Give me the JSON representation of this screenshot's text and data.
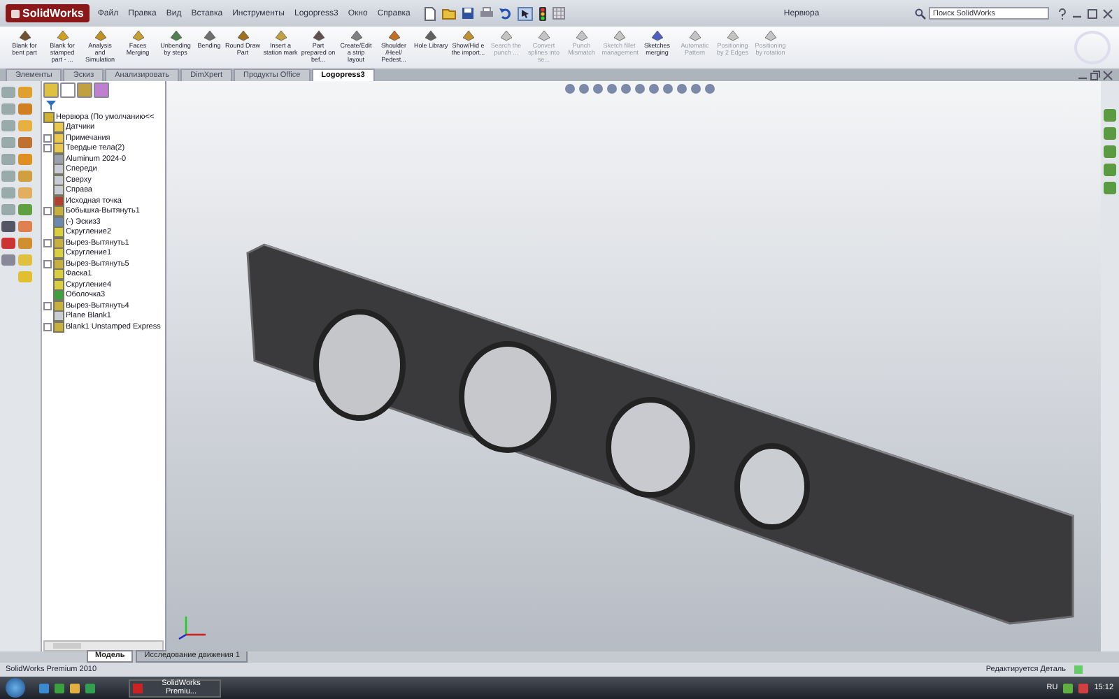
{
  "window": {
    "logo": "SolidWorks",
    "title": "Нервюра",
    "search": {
      "placeholder": "Поиск SolidWorks"
    }
  },
  "menu": [
    "Файл",
    "Правка",
    "Вид",
    "Вставка",
    "Инструменты",
    "Logopress3",
    "Окно",
    "Справка"
  ],
  "ribbon": [
    {
      "label": "Blank for bent part",
      "disabled": false
    },
    {
      "label": "Blank for stamped part - ...",
      "disabled": false
    },
    {
      "label": "Analysis and Simulation",
      "disabled": false
    },
    {
      "label": "Faces Merging",
      "disabled": false
    },
    {
      "label": "Unbending by steps",
      "disabled": false
    },
    {
      "label": "Bending",
      "disabled": false
    },
    {
      "label": "Round Draw Part",
      "disabled": false
    },
    {
      "label": "Insert a station mark",
      "disabled": false
    },
    {
      "label": "Part prepared on bef...",
      "disabled": false
    },
    {
      "label": "Create/Edit a strip layout",
      "disabled": false
    },
    {
      "label": "Shoulder /Heel/ Pedest...",
      "disabled": false
    },
    {
      "label": "Hole Library",
      "disabled": false
    },
    {
      "label": "Show/Hid e the import...",
      "disabled": false
    },
    {
      "label": "Search the punch ...",
      "disabled": true
    },
    {
      "label": "Convert splines into se...",
      "disabled": true
    },
    {
      "label": "Punch Mismatch",
      "disabled": true
    },
    {
      "label": "Sketch fillet management",
      "disabled": true
    },
    {
      "label": "Sketches merging",
      "disabled": false
    },
    {
      "label": "Automatic Pattern",
      "disabled": true
    },
    {
      "label": "Positioning by 2 Edges",
      "disabled": true
    },
    {
      "label": "Positioning by rotation",
      "disabled": true
    }
  ],
  "command_tabs": [
    {
      "label": "Элементы",
      "selected": false
    },
    {
      "label": "Эскиз",
      "selected": false
    },
    {
      "label": "Анализировать",
      "selected": false
    },
    {
      "label": "DimXpert",
      "selected": false
    },
    {
      "label": "Продукты Office",
      "selected": false
    },
    {
      "label": "Logopress3",
      "selected": true
    }
  ],
  "tree": {
    "root": "Нервюра  (По умолчанию<<",
    "items": [
      {
        "label": "Датчики",
        "kind": "folder",
        "collapsed": false
      },
      {
        "label": "Примечания",
        "kind": "folder",
        "collapsed": true
      },
      {
        "label": "Твердые тела(2)",
        "kind": "folder",
        "collapsed": true
      },
      {
        "label": "Aluminum 2024-0",
        "kind": "material",
        "collapsed": false
      },
      {
        "label": "Спереди",
        "kind": "plane",
        "collapsed": false
      },
      {
        "label": "Сверху",
        "kind": "plane",
        "collapsed": false
      },
      {
        "label": "Справа",
        "kind": "plane",
        "collapsed": false
      },
      {
        "label": "Исходная точка",
        "kind": "origin",
        "collapsed": false
      },
      {
        "label": "Бобышка-Вытянуть1",
        "kind": "feature",
        "collapsed": true
      },
      {
        "label": "(-) Эскиз3",
        "kind": "sketch",
        "collapsed": false
      },
      {
        "label": "Скругление2",
        "kind": "fillet",
        "collapsed": false
      },
      {
        "label": "Вырез-Вытянуть1",
        "kind": "feature",
        "collapsed": true
      },
      {
        "label": "Скругление1",
        "kind": "fillet",
        "collapsed": false
      },
      {
        "label": "Вырез-Вытянуть5",
        "kind": "feature",
        "collapsed": true
      },
      {
        "label": "Фаска1",
        "kind": "fillet",
        "collapsed": false
      },
      {
        "label": "Скругление4",
        "kind": "fillet",
        "collapsed": false
      },
      {
        "label": "Оболочка3",
        "kind": "shell",
        "collapsed": false
      },
      {
        "label": "Вырез-Вытянуть4",
        "kind": "feature",
        "collapsed": true
      },
      {
        "label": "Plane Blank1",
        "kind": "plane",
        "collapsed": false
      },
      {
        "label": "Blank1 Unstamped Express",
        "kind": "feature",
        "collapsed": true
      }
    ]
  },
  "bottom_tabs": [
    {
      "label": "Модель",
      "selected": true
    },
    {
      "label": "Исследование движения 1",
      "selected": false
    }
  ],
  "status_bar": {
    "product": "SolidWorks Premium 2010",
    "mode": "Редактируется Деталь"
  },
  "taskbar": {
    "task": "SolidWorks Premiu...",
    "language": "RU",
    "clock": "15:12"
  }
}
